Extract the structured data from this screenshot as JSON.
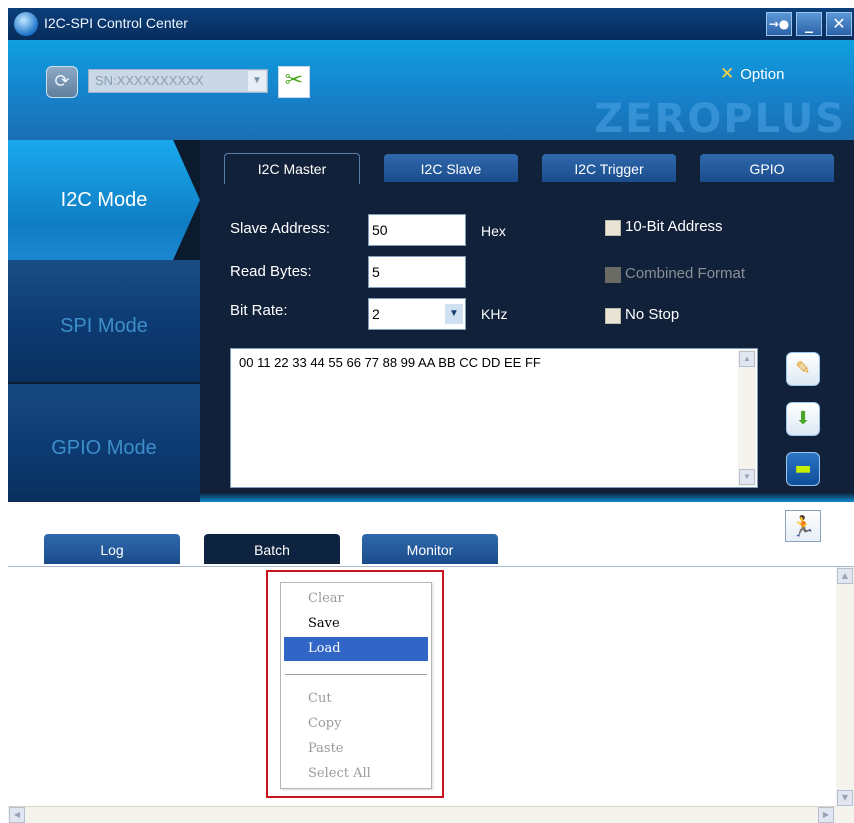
{
  "window": {
    "title": "I2C-SPI Control Center",
    "controls": {
      "pin": "→●",
      "minimize": "_",
      "close": "✕"
    }
  },
  "header": {
    "serial_value": "SN:XXXXXXXXXX",
    "option_label": "Option",
    "brand": "ZEROPLUS"
  },
  "modes": [
    {
      "label": "I2C Mode"
    },
    {
      "label": "SPI Mode"
    },
    {
      "label": "GPIO Mode"
    }
  ],
  "i2c_tabs": [
    "I2C Master",
    "I2C Slave",
    "I2C Trigger",
    "GPIO"
  ],
  "form": {
    "slave_address_label": "Slave Address:",
    "slave_address_value": "50",
    "slave_address_unit": "Hex",
    "read_bytes_label": "Read Bytes:",
    "read_bytes_value": "5",
    "bit_rate_label": "Bit Rate:",
    "bit_rate_value": "2",
    "bit_rate_unit": "KHz",
    "ten_bit_label": "10-Bit Address",
    "combined_label": "Combined Format",
    "no_stop_label": "No Stop",
    "data_text": "00 11 22 33 44 55 66 77 88 99 AA BB CC DD EE FF"
  },
  "lower_tabs": [
    "Log",
    "Batch",
    "Monitor"
  ],
  "context_menu": {
    "items": [
      {
        "label": "Clear",
        "state": "disabled"
      },
      {
        "label": "Save",
        "state": "enabled"
      },
      {
        "label": "Load",
        "state": "selected"
      },
      {
        "label": "Cut",
        "state": "disabled"
      },
      {
        "label": "Copy",
        "state": "disabled"
      },
      {
        "label": "Paste",
        "state": "disabled"
      },
      {
        "label": "Select All",
        "state": "disabled"
      }
    ]
  },
  "colors": {
    "accent": "#1aa9ee",
    "selection": "#3165c6",
    "highlight": "#c8141d"
  }
}
